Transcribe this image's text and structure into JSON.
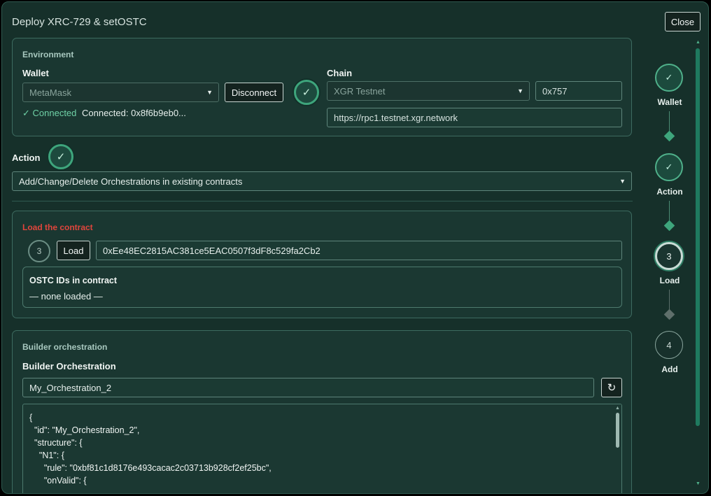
{
  "window": {
    "title": "Deploy XRC-729 & setOSTC",
    "close_label": "Close"
  },
  "environment": {
    "title": "Environment",
    "wallet_label": "Wallet",
    "wallet_value": "MetaMask",
    "disconnect_label": "Disconnect",
    "status_ok": "✓ Connected",
    "status_text": "Connected: 0x8f6b9eb0...",
    "check_icon": "✓",
    "chain_label": "Chain",
    "chain_value": "XGR Testnet",
    "chain_id": "0x757",
    "rpc_url": "https://rpc1.testnet.xgr.network"
  },
  "action": {
    "label": "Action",
    "check_icon": "✓",
    "value": "Add/Change/Delete Orchestrations in existing contracts"
  },
  "load_contract": {
    "title": "Load the contract",
    "title_color": "#e0453c",
    "step_number": "3",
    "load_label": "Load",
    "address": "0xEe48EC2815AC381ce5EAC0507f3dF8c529fa2Cb2",
    "ostc_title": "OSTC IDs in contract",
    "ostc_empty": "— none loaded —"
  },
  "builder": {
    "title": "Builder orchestration",
    "label": "Builder Orchestration",
    "name_value": "My_Orchestration_2",
    "refresh_icon": "↻",
    "code_lines": [
      "{",
      "  \"id\": \"My_Orchestration_2\",",
      "  \"structure\": {",
      "    \"N1\": {",
      "      \"rule\": \"0xbf81c1d8176e493cacac2c03713b928cf2ef25bc\",",
      "      \"onValid\": {"
    ]
  },
  "stepper": {
    "steps": [
      {
        "marker": "✓",
        "label": "Wallet",
        "state": "done"
      },
      {
        "marker": "✓",
        "label": "Action",
        "state": "done"
      },
      {
        "marker": "3",
        "label": "Load",
        "state": "current"
      },
      {
        "marker": "4",
        "label": "Add",
        "state": "todo"
      }
    ]
  },
  "colors": {
    "accent": "#3ea57c",
    "background": "#16302a",
    "error": "#e0453c"
  }
}
